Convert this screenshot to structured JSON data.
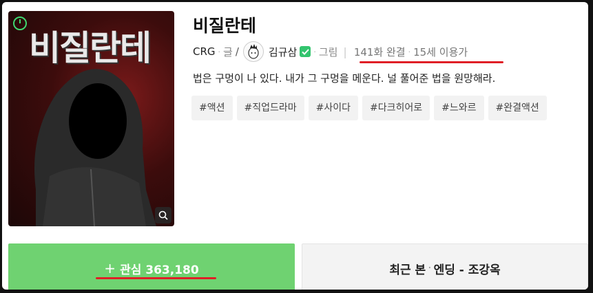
{
  "cover": {
    "title_art": "비질란테",
    "timer_icon": "timer-icon",
    "zoom_icon": "search-icon"
  },
  "title": "비질란테",
  "meta": {
    "writer": "CRG",
    "writer_role": "글",
    "slash": "/",
    "artist": "김규삼",
    "artist_role": "그림",
    "episodes": "141화 완결",
    "age": "15세 이용가",
    "dot": "·"
  },
  "description": "법은 구멍이 나 있다. 내가 그 구멍을 메운다. 널 풀어준 법을 원망해라.",
  "tags": [
    "#액션",
    "#직업드라마",
    "#사이다",
    "#다크히어로",
    "#느와르",
    "#완결액션"
  ],
  "actions": {
    "favorite_plus": "+",
    "favorite_label": "관심 363,180",
    "recent_label": "최근 본",
    "recent_dot": "·",
    "recent_episode": "엔딩 - 조강옥"
  },
  "colors": {
    "favorite_bg": "#6fd271",
    "highlight_underline": "#e01f26",
    "verified": "#33c46e"
  }
}
